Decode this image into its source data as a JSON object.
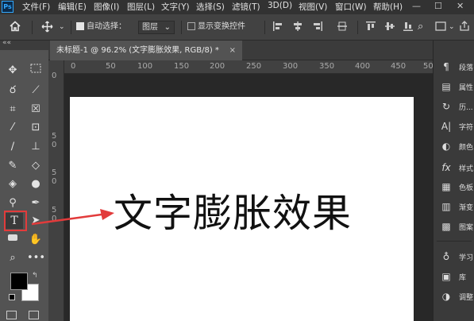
{
  "app": {
    "logo_text": "Ps",
    "colors": {
      "accent": "#31a8ff",
      "highlight": "#e23b3b",
      "canvas": "#ffffff"
    }
  },
  "menu": [
    "文件(F)",
    "编辑(E)",
    "图像(I)",
    "图层(L)",
    "文字(Y)",
    "选择(S)",
    "滤镜(T)",
    "3D(D)",
    "视图(V)",
    "窗口(W)",
    "帮助(H)"
  ],
  "window_controls": {
    "minimize": "—",
    "maximize": "☐"
  },
  "options_bar": {
    "home_icon": "home-icon",
    "move_icon": "move-icon",
    "auto_select_label": "自动选择：",
    "auto_select_checked": true,
    "auto_select_value": "图层",
    "transform_label": "显示变换控件",
    "transform_checked": false
  },
  "document": {
    "tab_title": "未标题-1 @ 96.2% (文字膨胀效果, RGB/8) *",
    "canvas_text": "文字膨胀效果",
    "ruler_h_labels": [
      "0",
      "50",
      "100",
      "150",
      "200",
      "250",
      "300",
      "350",
      "400",
      "450",
      "50"
    ],
    "ruler_v_labels": [
      "0",
      "5",
      "0",
      "5",
      "0",
      "5",
      "0"
    ]
  },
  "tools": {
    "panel_toggle": "««",
    "items": [
      "move-tool",
      "marquee-tool",
      "lasso-tool",
      "quick-select-tool",
      "crop-tool",
      "frame-tool",
      "eyedropper-tool",
      "spot-heal-tool",
      "brush-tool",
      "stamp-tool",
      "history-brush-tool",
      "eraser-tool",
      "gradient-tool",
      "blur-tool",
      "dodge-tool",
      "pen-tool",
      "type-tool",
      "path-select-tool",
      "shape-tool",
      "hand-tool",
      "zoom-tool",
      "more-tools"
    ],
    "selected": "type-tool",
    "foreground_color": "#000000",
    "background_color": "#ffffff"
  },
  "panels": {
    "group1": [
      "段落",
      "属性",
      "历...",
      "字符",
      "颜色",
      "样式",
      "色板",
      "渐变",
      "图案"
    ],
    "group2": [
      "学习",
      "库",
      "调整"
    ]
  }
}
